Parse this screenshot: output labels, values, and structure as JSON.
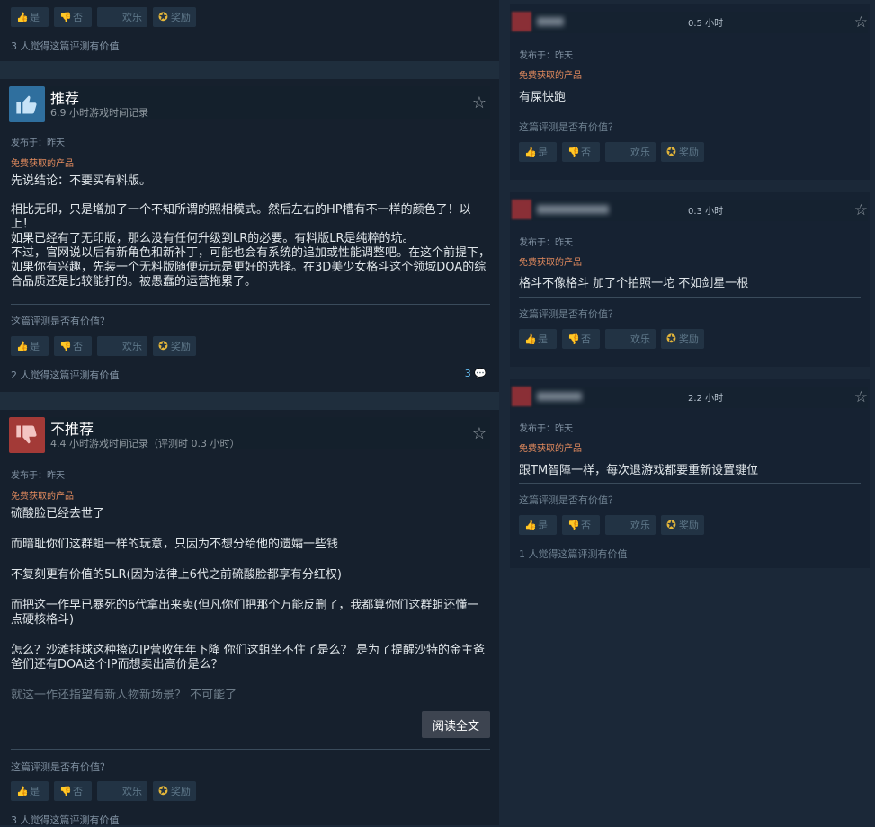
{
  "vote": {
    "yes": "是",
    "no": "否",
    "fun": "欢乐",
    "award": "奖励"
  },
  "top_partial": {
    "helpful": "3 人觉得这篇评测有价值"
  },
  "reviews_left": [
    {
      "title": "推荐",
      "hours": "6.9 小时游戏时间记录",
      "posted": "发布于：昨天",
      "free": "免费获取的产品",
      "lines": [
        "先说结论：不要买有料版。",
        "",
        "相比无印，只是增加了一个不知所谓的照相模式。然后左右的HP槽有不一样的颜色了！以上！",
        "如果已经有了无印版，那么没有任何升级到LR的必要。有料版LR是纯粹的坑。",
        "不过，官网说以后有新角色和新补丁，可能也会有系统的追加或性能调整吧。在这个前提下，如果你有兴趣，先装一个无料版随便玩玩是更好的选择。在3D美少女格斗这个领域DOA的综合品质还是比较能打的。被愚蠢的运营拖累了。"
      ],
      "question": "这篇评测是否有价值？",
      "helpful": "2 人觉得这篇评测有价值",
      "comments": "3"
    },
    {
      "title": "不推荐",
      "hours": "4.4 小时游戏时间记录（评测时 0.3 小时）",
      "posted": "发布于：昨天",
      "free": "免费获取的产品",
      "lines": [
        "硫酸脸已经去世了",
        "而暗耻你们这群蛆一样的玩意，只因为不想分给他的遗孀一些钱",
        "不复刻更有价值的5LR(因为法律上6代之前硫酸脸都享有分红权)",
        "而把这一作早已暴死的6代拿出来卖(但凡你们把那个万能反删了，我都算你们这群蛆还懂一点硬核格斗)",
        "怎么？沙滩排球这种擦边IP营收年年下降 你们这蛆坐不住了是么？ 是为了提醒沙特的金主爸爸们还有DOA这个IP而想卖出高价是么？",
        "就这一作还指望有新人物新场景？ 不可能了"
      ],
      "read_more": "阅读全文",
      "question": "这篇评测是否有价值？",
      "helpful": "3 人觉得这篇评测有价值"
    }
  ],
  "reviews_right": [
    {
      "hours": "0.5 小时",
      "posted": "发布于：昨天",
      "free": "免费获取的产品",
      "text": "有屎快跑",
      "question": "这篇评测是否有价值？",
      "helpful": ""
    },
    {
      "hours": "0.3 小时",
      "posted": "发布于：昨天",
      "free": "免费获取的产品",
      "text": "格斗不像格斗 加了个拍照一坨 不如剑星一根",
      "question": "这篇评测是否有价值？",
      "helpful": ""
    },
    {
      "hours": "2.2 小时",
      "posted": "发布于：昨天",
      "free": "免费获取的产品",
      "text": "跟TM智障一样，每次退游戏都要重新设置键位",
      "question": "这篇评测是否有价值？",
      "helpful": "1 人觉得这篇评测有价值"
    }
  ],
  "colors": {
    "bg": "#1b2838",
    "accent": "#66c0f4",
    "free": "#e58c5e",
    "thumb_up": "#2f6f9e",
    "thumb_down": "#a33a37"
  }
}
